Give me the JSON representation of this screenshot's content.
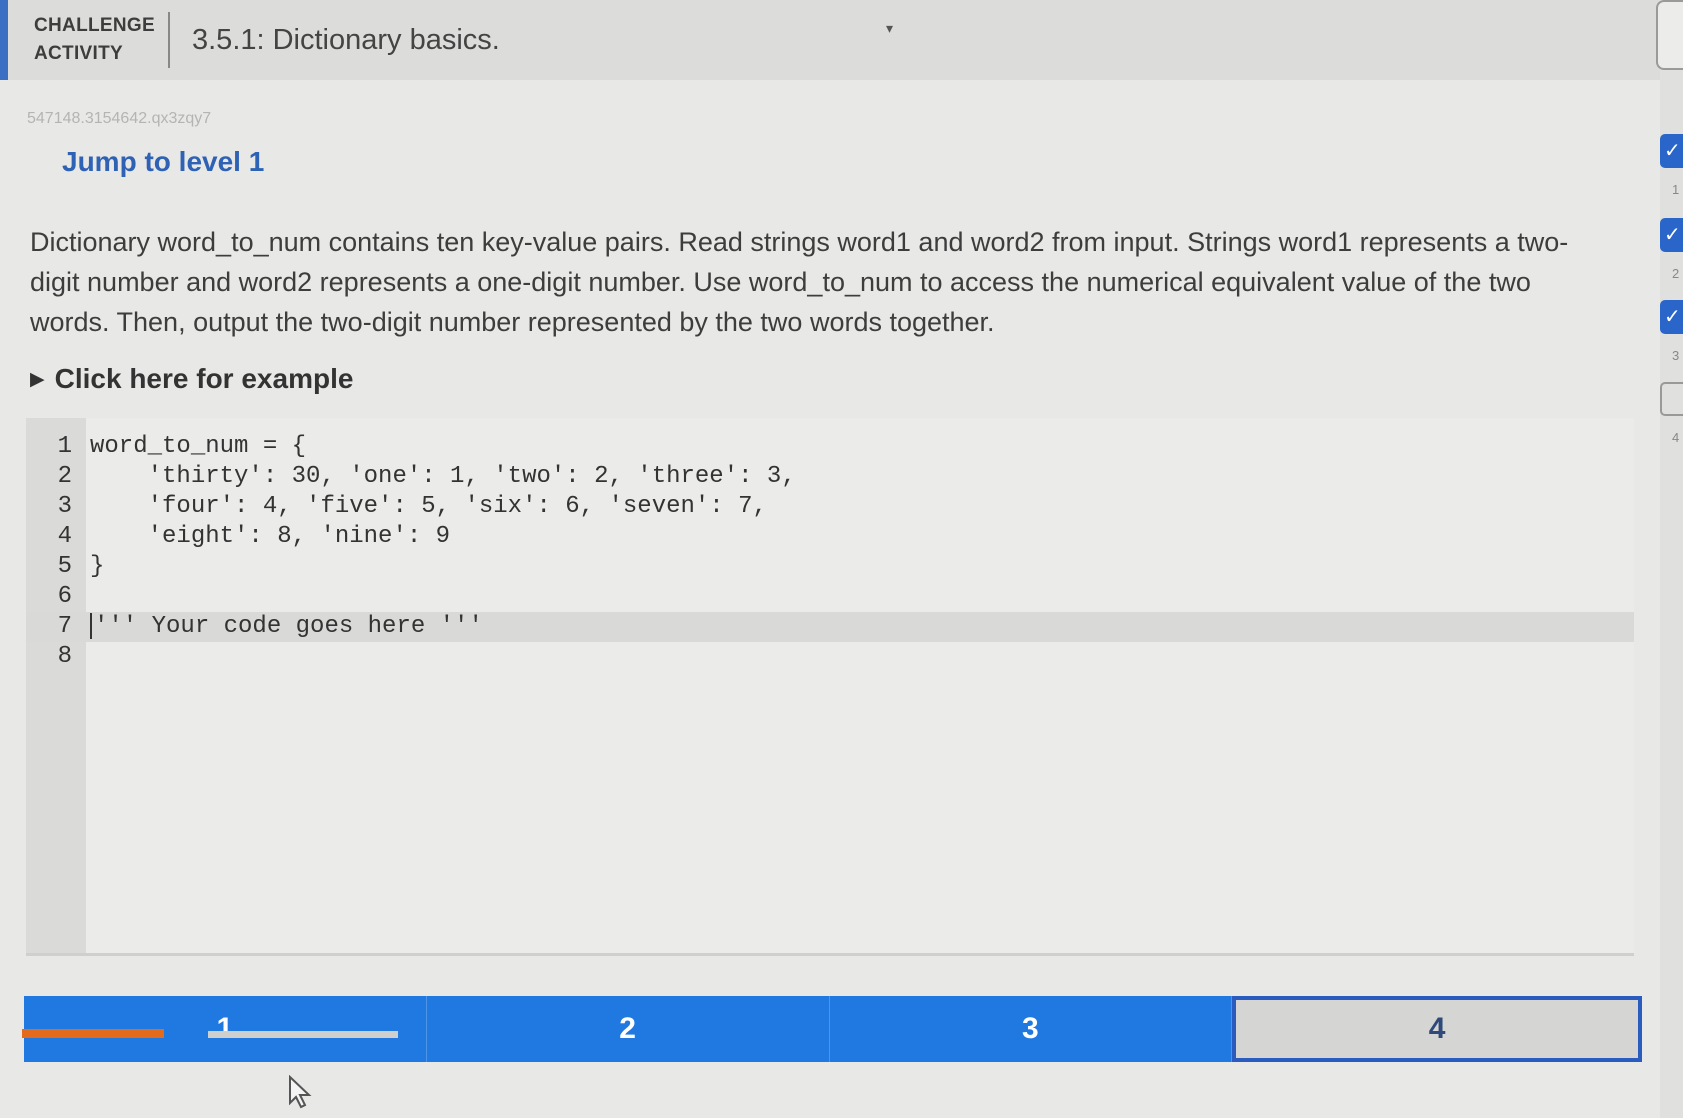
{
  "header": {
    "label_line1": "CHALLENGE",
    "label_line2": "ACTIVITY",
    "title": "3.5.1: Dictionary basics."
  },
  "activity_id": "547148.3154642.qx3zqy7",
  "jump_link": "Jump to level 1",
  "instructions": "Dictionary word_to_num contains ten key-value pairs. Read strings word1 and word2 from input. Strings word1 represents a two-digit number and word2 represents a one-digit number. Use word_to_num to access the numerical equivalent value of the two words. Then, output the two-digit number represented by the two words together.",
  "example_toggle": "Click here for example",
  "editor": {
    "lines": [
      {
        "num": "1",
        "text": "word_to_num = {"
      },
      {
        "num": "2",
        "text": "    'thirty': 30, 'one': 1, 'two': 2, 'three': 3,"
      },
      {
        "num": "3",
        "text": "    'four': 4, 'five': 5, 'six': 6, 'seven': 7,"
      },
      {
        "num": "4",
        "text": "    'eight': 8, 'nine': 9"
      },
      {
        "num": "5",
        "text": "}"
      },
      {
        "num": "6",
        "text": ""
      },
      {
        "num": "7",
        "text": "''' Your code goes here '''"
      },
      {
        "num": "8",
        "text": ""
      }
    ]
  },
  "levels": [
    {
      "label": "1",
      "state": "complete"
    },
    {
      "label": "2",
      "state": "complete"
    },
    {
      "label": "3",
      "state": "complete"
    },
    {
      "label": "4",
      "state": "current"
    }
  ],
  "sidebar": {
    "numbers": [
      "1",
      "2",
      "3",
      "4"
    ]
  },
  "colors": {
    "accent": "#2079e0",
    "link": "#2e62b5",
    "header_border": "#3a6fc4",
    "orange": "#e46a1c"
  }
}
